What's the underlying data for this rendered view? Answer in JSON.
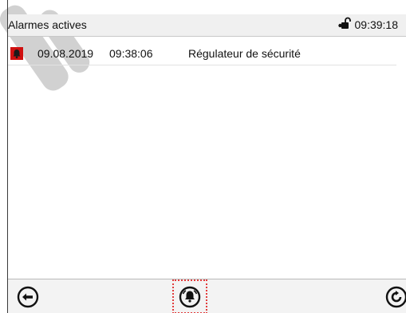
{
  "header": {
    "title": "Alarmes actives",
    "time": "09:39:18",
    "lock_icon": "lock-icon"
  },
  "alarms": [
    {
      "date": "09.08.2019",
      "time": "09:38:06",
      "text": "Régulateur de sécurité",
      "icon": "alarm-bell-icon"
    }
  ],
  "footer": {
    "back_icon": "back-arrow-icon",
    "acknowledge_icon": "acknowledge-alarm-icon",
    "refresh_icon": "refresh-icon"
  },
  "colors": {
    "alarm_red": "#d01010",
    "highlight": "#e23c3c",
    "titlebar_bg": "#f0f0f0"
  }
}
